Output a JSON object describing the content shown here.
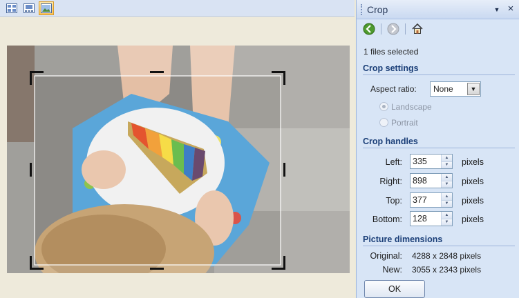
{
  "toolbar": {
    "buttons": [
      {
        "name": "thumbnails-view-icon",
        "active": false
      },
      {
        "name": "filmstrip-view-icon",
        "active": false
      },
      {
        "name": "single-picture-view-icon",
        "active": true
      }
    ]
  },
  "editor": {
    "photo": "child-eating-rainbow-cake-photo"
  },
  "pane": {
    "title": "Crop",
    "files_selected": "1 files selected",
    "sections": {
      "settings": "Crop settings",
      "handles": "Crop handles",
      "dimensions": "Picture dimensions"
    },
    "aspect": {
      "label": "Aspect ratio:",
      "value": "None"
    },
    "orientation": {
      "landscape": "Landscape",
      "portrait": "Portrait",
      "selected": "landscape"
    },
    "handles": {
      "left": {
        "label": "Left:",
        "value": "335"
      },
      "right": {
        "label": "Right:",
        "value": "898"
      },
      "top": {
        "label": "Top:",
        "value": "377"
      },
      "bottom": {
        "label": "Bottom:",
        "value": "128"
      },
      "unit": "pixels"
    },
    "dimensions": {
      "original_label": "Original:",
      "original_value": "4288 x 2848 pixels",
      "new_label": "New:",
      "new_value": "3055 x 2343 pixels"
    },
    "ok_label": "OK"
  },
  "colors": {
    "toolbar_bg": "#d9e3f3",
    "pane_bg": "#d8e5f6",
    "section_heading": "#1b3f78",
    "active_button": "#f7c15a"
  }
}
